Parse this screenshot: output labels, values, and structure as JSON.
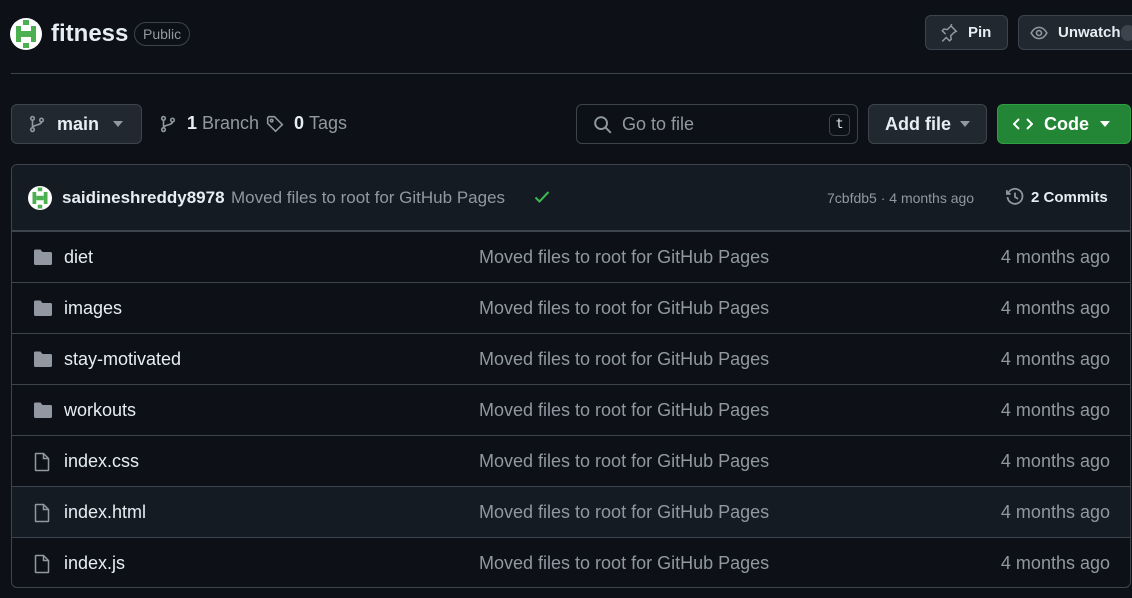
{
  "repo": {
    "name": "fitness",
    "visibility": "Public",
    "pin_label": "Pin",
    "unwatch_label": "Unwatch"
  },
  "toolbar": {
    "branch": "main",
    "branches_count": "1",
    "branches_label": "Branch",
    "tags_count": "0",
    "tags_label": "Tags",
    "search_placeholder": "Go to file",
    "search_shortcut": "t",
    "add_file_label": "Add file",
    "code_label": "Code"
  },
  "commit": {
    "author": "saidineshreddy8978",
    "message": "Moved files to root for GitHub Pages",
    "sha_time": "7cbfdb5 · 4 months ago",
    "commits_count": "2 Commits"
  },
  "files": [
    {
      "name": "diet",
      "type": "folder",
      "message": "Moved files to root for GitHub Pages",
      "age": "4 months ago"
    },
    {
      "name": "images",
      "type": "folder",
      "message": "Moved files to root for GitHub Pages",
      "age": "4 months ago"
    },
    {
      "name": "stay-motivated",
      "type": "folder",
      "message": "Moved files to root for GitHub Pages",
      "age": "4 months ago"
    },
    {
      "name": "workouts",
      "type": "folder",
      "message": "Moved files to root for GitHub Pages",
      "age": "4 months ago"
    },
    {
      "name": "index.css",
      "type": "file",
      "message": "Moved files to root for GitHub Pages",
      "age": "4 months ago"
    },
    {
      "name": "index.html",
      "type": "file",
      "message": "Moved files to root for GitHub Pages",
      "age": "4 months ago"
    },
    {
      "name": "index.js",
      "type": "file",
      "message": "Moved files to root for GitHub Pages",
      "age": "4 months ago"
    }
  ],
  "colors": {
    "background": "#0d1117",
    "border": "#3d444d",
    "text": "#e6edf3",
    "muted": "#9198a1",
    "code_button": "#238636",
    "check": "#3fb950"
  }
}
